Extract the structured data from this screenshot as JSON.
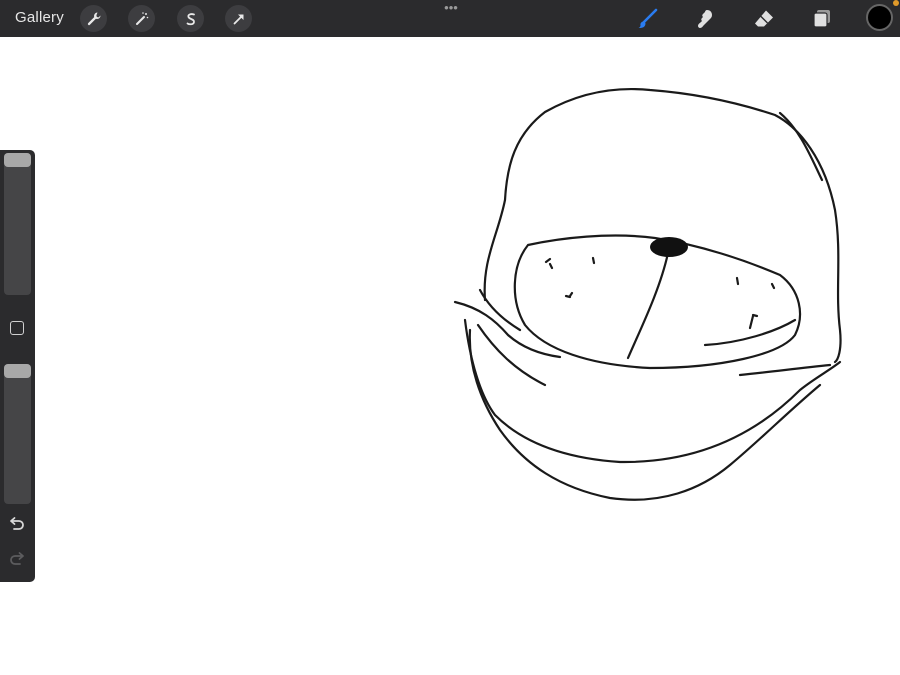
{
  "topbar": {
    "gallery_label": "Gallery",
    "left_tools": [
      "wrench-icon",
      "magic-wand-icon",
      "selection-icon",
      "transform-arrow-icon"
    ],
    "more_dots": "•••",
    "right_tools": [
      "brush-icon",
      "smudge-icon",
      "eraser-icon",
      "layers-icon"
    ],
    "active_tool": "brush-icon",
    "current_color": "#000000",
    "accent_color": "#2a7cf0",
    "notification_color": "#e09a2a"
  },
  "sidebar": {
    "brush_size_level": 0.0,
    "opacity_level": 0.0,
    "modify_button": "square-icon",
    "undo": "undo-icon",
    "redo": "redo-icon"
  }
}
